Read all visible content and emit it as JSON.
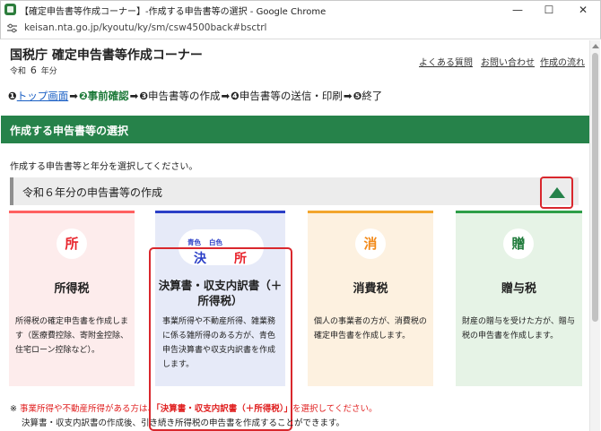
{
  "window": {
    "title": "【確定申告書等作成コーナー】-作成する申告書等の選択 - Google Chrome",
    "minimize": "—",
    "maximize": "☐",
    "close": "✕"
  },
  "address_bar": {
    "url": "keisan.nta.go.jp/kyoutu/ky/sm/csw4500back#bsctrl"
  },
  "header": {
    "site_title": "国税庁 確定申告書等作成コーナー",
    "era_prefix": "令和",
    "era_year": "6",
    "era_suffix": "年分",
    "links": {
      "faq": "よくある質問",
      "contact": "お問い合わせ",
      "flow": "作成の流れ"
    }
  },
  "steps": [
    {
      "num": "❶",
      "label": "トップ画面"
    },
    {
      "num": "❷",
      "label": "事前確認"
    },
    {
      "num": "❸",
      "label": "申告書等の作成"
    },
    {
      "num": "❹",
      "label": "申告書等の送信・印刷"
    },
    {
      "num": "❺",
      "label": "終了"
    }
  ],
  "step_arrow": "➡",
  "section": {
    "heading": "作成する申告書等の選択",
    "instruction": "作成する申告書等と年分を選択してください。",
    "year_heading": "令和６年分の申告書等の作成"
  },
  "cards": {
    "income": {
      "icon": "所",
      "title": "所得税",
      "desc": "所得税の確定申告書を作成します（医療費控除、寄附金控除、住宅ローン控除など）。"
    },
    "settlement": {
      "small_blue": "青色",
      "small_white": "白色",
      "icon_a": "決",
      "icon_b": "所",
      "title": "決算書・収支内訳書（＋所得税）",
      "desc": "事業所得や不動産所得、雑業務に係る雑所得のある方が、青色申告決算書や収支内訳書を作成します。"
    },
    "consumption": {
      "icon": "消",
      "title": "消費税",
      "desc": "個人の事業者の方が、消費税の確定申告書を作成します。"
    },
    "gift": {
      "icon": "贈",
      "title": "贈与税",
      "desc": "財産の贈与を受けた方が、贈与税の申告書を作成します。"
    }
  },
  "notes": {
    "mark": "※",
    "line1_a": "事業所得や不動産所得がある方は、",
    "line1_b": "「決算書・収支内訳書（＋所得税）」",
    "line1_c": "を選択してください。",
    "line2": "決算書・収支内訳書の作成後、引き続き所得税の申告書を作成することができます。"
  },
  "colors": {
    "green": "#26824a",
    "highlight_red": "#d9272d",
    "income_accent": "#ff6060",
    "settlement_accent": "#2b3fc7",
    "consumption_accent": "#f3a52c",
    "gift_accent": "#2e9e48"
  },
  "icons": {
    "scroll_up": "triangle-up-icon",
    "site_settings": "tune-icon"
  }
}
